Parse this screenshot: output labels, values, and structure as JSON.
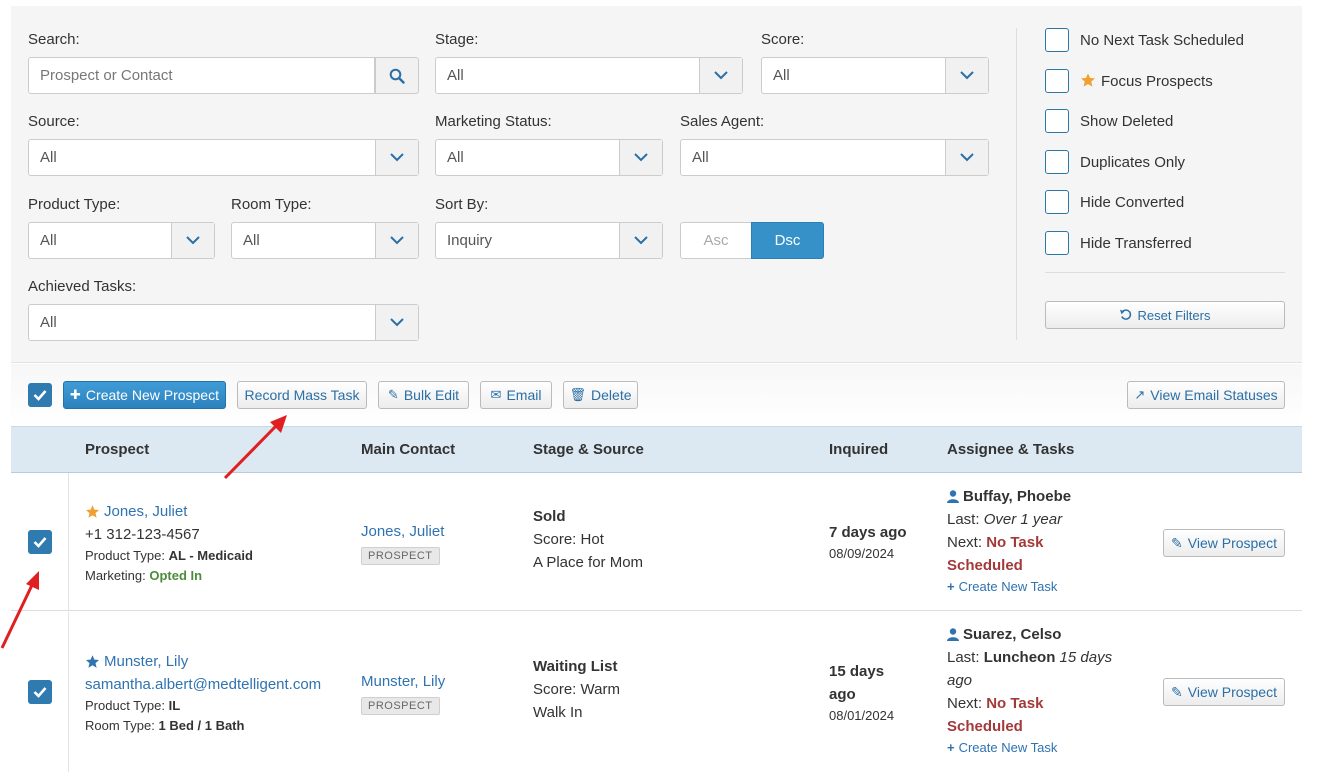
{
  "filters": {
    "search": {
      "label": "Search:",
      "placeholder": "Prospect or Contact"
    },
    "stage": {
      "label": "Stage:",
      "value": "All"
    },
    "score": {
      "label": "Score:",
      "value": "All"
    },
    "source": {
      "label": "Source:",
      "value": "All"
    },
    "marketing_status": {
      "label": "Marketing Status:",
      "value": "All"
    },
    "sales_agent": {
      "label": "Sales Agent:",
      "value": "All"
    },
    "product_type": {
      "label": "Product Type:",
      "value": "All"
    },
    "room_type": {
      "label": "Room Type:",
      "value": "All"
    },
    "sort_by": {
      "label": "Sort By:",
      "value": "Inquiry"
    },
    "asc_label": "Asc",
    "dsc_label": "Dsc",
    "achieved_tasks": {
      "label": "Achieved Tasks:",
      "value": "All"
    }
  },
  "checkboxes": [
    {
      "label": "No Next Task Scheduled",
      "checked": false
    },
    {
      "label": "Focus Prospects",
      "checked": false
    },
    {
      "label": "Show Deleted",
      "checked": false
    },
    {
      "label": "Duplicates Only",
      "checked": false
    },
    {
      "label": "Hide Converted",
      "checked": false
    },
    {
      "label": "Hide Transferred",
      "checked": false
    }
  ],
  "reset_label": "Reset Filters",
  "toolbar": {
    "create": "Create New Prospect",
    "mass_task": "Record Mass Task",
    "bulk_edit": "Bulk Edit",
    "email": "Email",
    "delete": "Delete",
    "view_email_statuses": "View Email Statuses"
  },
  "table": {
    "headers": [
      "Prospect",
      "Main Contact",
      "Stage & Source",
      "Inquired",
      "Assignee & Tasks"
    ],
    "rows": [
      {
        "name": "Jones, Juliet",
        "contact_line": "+1 312-123-4567",
        "detail1_label": "Product Type:",
        "detail1_value": "AL - Medicaid",
        "detail2_label": "Marketing:",
        "detail2_value": "Opted In",
        "main_contact": "Jones, Juliet",
        "badge": "PROSPECT",
        "stage": "Sold",
        "score": "Score: Hot",
        "source": "A Place for Mom",
        "inquired_rel_1": "7 days ago",
        "inquired_rel_2": "",
        "inquired_date": "08/09/2024",
        "assignee": "Buffay, Phoebe",
        "last_label": "Last:",
        "last_bold": "",
        "last_italic_1": "Over 1 year",
        "last_italic_2": "",
        "next_label": "Next:",
        "next_value_1": "No Task",
        "next_value_2": "Scheduled",
        "create_task": "Create New Task",
        "view": "View Prospect",
        "star_color": "#f0a030",
        "checked": true
      },
      {
        "name": "Munster, Lily",
        "contact_line": "samantha.albert@medtelligent.com",
        "detail1_label": "Product Type:",
        "detail1_value": "IL",
        "detail2_label": "Room Type:",
        "detail2_value": "1 Bed / 1 Bath",
        "main_contact": "Munster, Lily",
        "badge": "PROSPECT",
        "stage": "Waiting List",
        "score": "Score: Warm",
        "source": "Walk In",
        "inquired_rel_1": "15 days",
        "inquired_rel_2": "ago",
        "inquired_date": "08/01/2024",
        "assignee": "Suarez, Celso",
        "last_label": "Last:",
        "last_bold": "Luncheon",
        "last_italic_1": "15 days",
        "last_italic_2": "ago",
        "next_label": "Next:",
        "next_value_1": "No Task",
        "next_value_2": "Scheduled",
        "create_task": "Create New Task",
        "view": "View Prospect",
        "star_color": "#2f73b0",
        "checked": true
      }
    ]
  },
  "colors": {
    "accent": "#3591c8",
    "link": "#2f73b0",
    "danger": "#a33a3a",
    "annotation": "#e02020"
  }
}
